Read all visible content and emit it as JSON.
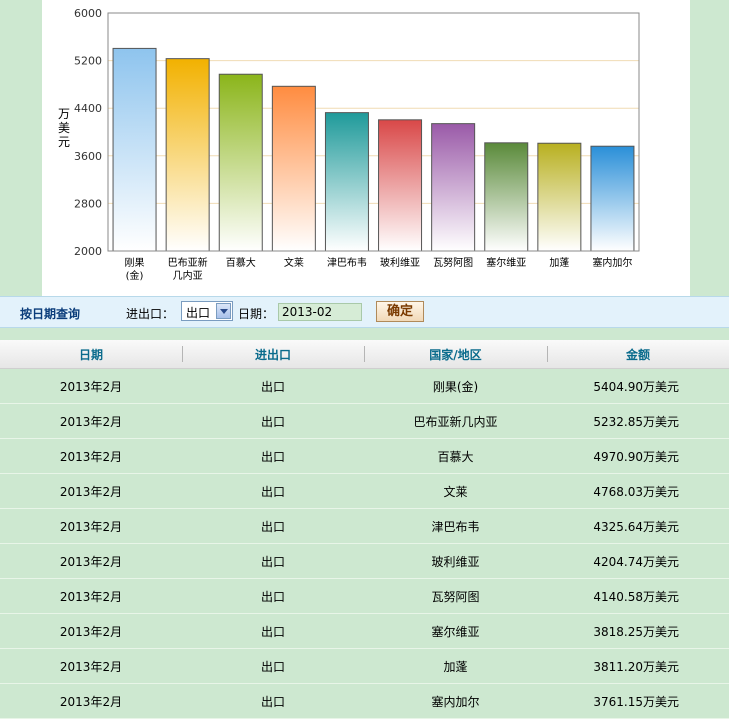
{
  "chart_data": {
    "type": "bar",
    "title": "",
    "xlabel": "",
    "ylabel": "万美元",
    "ylim": [
      2000,
      6000
    ],
    "yticks": [
      2000,
      2800,
      3600,
      4400,
      5200,
      6000
    ],
    "categories": [
      [
        "刚果",
        "(金)"
      ],
      [
        "巴布亚新",
        "几内亚"
      ],
      [
        "百慕大"
      ],
      [
        "文莱"
      ],
      [
        "津巴布韦"
      ],
      [
        "玻利维亚"
      ],
      [
        "瓦努阿图"
      ],
      [
        "塞尔维亚"
      ],
      [
        "加蓬"
      ],
      [
        "塞内加尔"
      ]
    ],
    "values": [
      5404.9,
      5232.85,
      4970.9,
      4768.03,
      4325.64,
      4204.74,
      4140.58,
      3818.25,
      3811.2,
      3761.15
    ],
    "colors": [
      "#8ec4ee",
      "#f2b100",
      "#8bb51a",
      "#ff8c40",
      "#1f9a9a",
      "#d94848",
      "#9a5aa8",
      "#5a8a3a",
      "#b8b020",
      "#2a8fd8"
    ],
    "grid": true,
    "legend": "none"
  },
  "filter": {
    "title": "按日期查询",
    "io_label": "进出口：",
    "io_value": "出口",
    "date_label": "日期：",
    "date_value": "2013-02",
    "confirm_label": "确定"
  },
  "table": {
    "headers": [
      "日期",
      "进出口",
      "国家/地区",
      "金额"
    ],
    "rows": [
      [
        "2013年2月",
        "出口",
        "刚果(金)",
        "5404.90万美元"
      ],
      [
        "2013年2月",
        "出口",
        "巴布亚新几内亚",
        "5232.85万美元"
      ],
      [
        "2013年2月",
        "出口",
        "百慕大",
        "4970.90万美元"
      ],
      [
        "2013年2月",
        "出口",
        "文莱",
        "4768.03万美元"
      ],
      [
        "2013年2月",
        "出口",
        "津巴布韦",
        "4325.64万美元"
      ],
      [
        "2013年2月",
        "出口",
        "玻利维亚",
        "4204.74万美元"
      ],
      [
        "2013年2月",
        "出口",
        "瓦努阿图",
        "4140.58万美元"
      ],
      [
        "2013年2月",
        "出口",
        "塞尔维亚",
        "3818.25万美元"
      ],
      [
        "2013年2月",
        "出口",
        "加蓬",
        "3811.20万美元"
      ],
      [
        "2013年2月",
        "出口",
        "塞内加尔",
        "3761.15万美元"
      ]
    ]
  }
}
